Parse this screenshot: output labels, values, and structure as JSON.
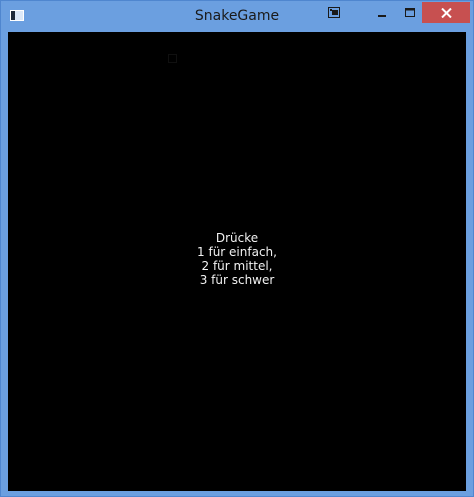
{
  "window": {
    "title": "SnakeGame",
    "close_color": "#c75050",
    "titlebar_color": "#6b9fe0"
  },
  "titlebar_buttons": {
    "pin_icon": "window-pin-icon",
    "minimize_icon": "minimize-icon",
    "maximize_icon": "maximize-icon",
    "close_icon": "close-icon"
  },
  "game": {
    "background_color": "#000000",
    "prompt_lines": [
      "Drücke",
      "1 für einfach,",
      "2 für mittel,",
      "3 für schwer"
    ]
  }
}
